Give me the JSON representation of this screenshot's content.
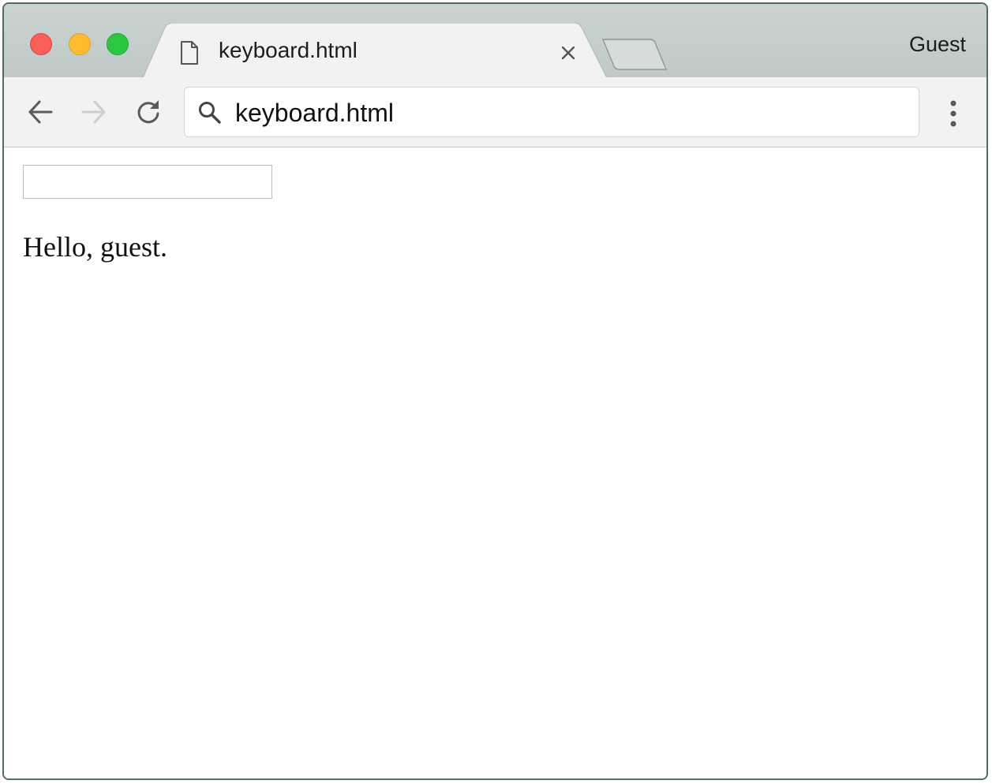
{
  "window": {
    "traffic_lights": [
      "close",
      "minimize",
      "zoom"
    ]
  },
  "tab": {
    "title": "keyboard.html",
    "icon": "document-icon",
    "close_icon": "close-icon"
  },
  "new_tab": {
    "icon": "new-tab-icon"
  },
  "profile": {
    "label": "Guest"
  },
  "toolbar": {
    "back_icon": "arrow-left-icon",
    "forward_icon": "arrow-right-icon",
    "reload_icon": "reload-icon",
    "menu_icon": "vertical-dots-icon"
  },
  "omnibox": {
    "icon": "search-icon",
    "text": "keyboard.html"
  },
  "page": {
    "input_value": "",
    "greeting": "Hello, guest."
  },
  "colors": {
    "close": "#fc5f57",
    "minimize": "#fdbc2e",
    "zoom": "#29c840",
    "window_border": "#4f6e63"
  }
}
